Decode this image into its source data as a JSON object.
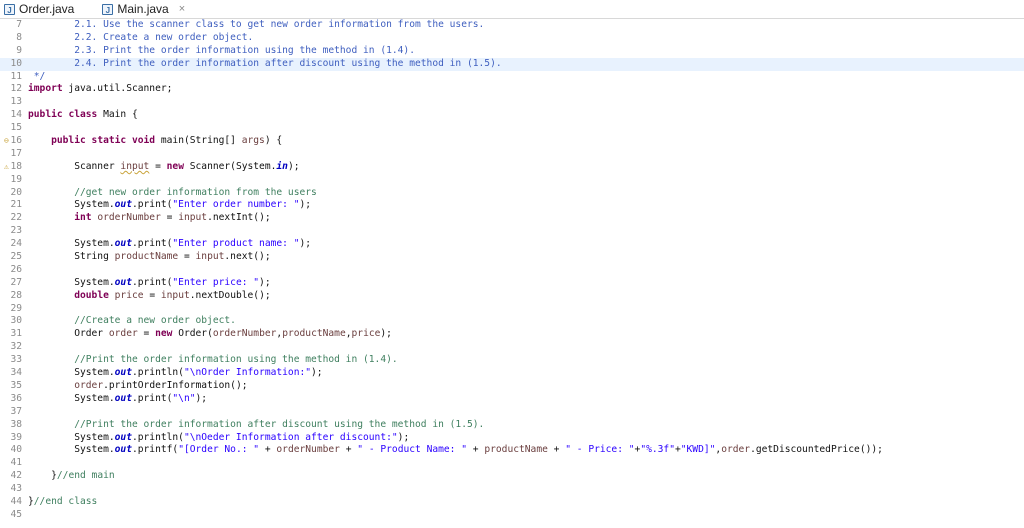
{
  "tabs": [
    {
      "label": "Order.java",
      "active": false
    },
    {
      "label": "Main.java",
      "active": true,
      "close": "×"
    }
  ],
  "editor": {
    "lines": [
      {
        "num": "7",
        "marker": "",
        "segments": [
          {
            "t": "        2.1. Use the scanner class to get new order information from the users.",
            "c": "doc"
          }
        ]
      },
      {
        "num": "8",
        "marker": "",
        "segments": [
          {
            "t": "        2.2. Create a new order object.",
            "c": "doc"
          }
        ]
      },
      {
        "num": "9",
        "marker": "",
        "segments": [
          {
            "t": "        2.3. Print the order information using the method in (1.4).",
            "c": "doc"
          }
        ]
      },
      {
        "num": "10",
        "marker": "",
        "hl": true,
        "segments": [
          {
            "t": "        2.4. Print the order information after discount using the method in (1.5).",
            "c": "doc"
          }
        ]
      },
      {
        "num": "11",
        "marker": "",
        "segments": [
          {
            "t": " */",
            "c": "doc"
          }
        ]
      },
      {
        "num": "12",
        "marker": "",
        "segments": [
          {
            "t": "import",
            "c": "kw"
          },
          {
            "t": " java.util.Scanner;",
            "c": ""
          }
        ]
      },
      {
        "num": "13",
        "marker": "",
        "segments": []
      },
      {
        "num": "14",
        "marker": "",
        "segments": [
          {
            "t": "public",
            "c": "kw"
          },
          {
            "t": " ",
            "c": ""
          },
          {
            "t": "class",
            "c": "kw"
          },
          {
            "t": " Main {",
            "c": ""
          }
        ]
      },
      {
        "num": "15",
        "marker": "",
        "segments": []
      },
      {
        "num": "16",
        "marker": "⊖",
        "segments": [
          {
            "t": "    ",
            "c": ""
          },
          {
            "t": "public",
            "c": "kw"
          },
          {
            "t": " ",
            "c": ""
          },
          {
            "t": "static",
            "c": "kw"
          },
          {
            "t": " ",
            "c": ""
          },
          {
            "t": "void",
            "c": "kw"
          },
          {
            "t": " main(String[] ",
            "c": ""
          },
          {
            "t": "args",
            "c": "var"
          },
          {
            "t": ") {",
            "c": ""
          }
        ]
      },
      {
        "num": "17",
        "marker": "",
        "segments": []
      },
      {
        "num": "18",
        "marker": "⚠",
        "segments": [
          {
            "t": "        Scanner ",
            "c": ""
          },
          {
            "t": "input",
            "c": "var warn"
          },
          {
            "t": " = ",
            "c": ""
          },
          {
            "t": "new",
            "c": "kw"
          },
          {
            "t": " Scanner(System.",
            "c": ""
          },
          {
            "t": "in",
            "c": "fld"
          },
          {
            "t": ");",
            "c": ""
          }
        ]
      },
      {
        "num": "19",
        "marker": "",
        "segments": []
      },
      {
        "num": "20",
        "marker": "",
        "segments": [
          {
            "t": "        //get new order information from the users",
            "c": "com"
          }
        ]
      },
      {
        "num": "21",
        "marker": "",
        "segments": [
          {
            "t": "        System.",
            "c": ""
          },
          {
            "t": "out",
            "c": "fld"
          },
          {
            "t": ".print(",
            "c": ""
          },
          {
            "t": "\"Enter order number: \"",
            "c": "str"
          },
          {
            "t": ");",
            "c": ""
          }
        ]
      },
      {
        "num": "22",
        "marker": "",
        "segments": [
          {
            "t": "        ",
            "c": ""
          },
          {
            "t": "int",
            "c": "kw"
          },
          {
            "t": " ",
            "c": ""
          },
          {
            "t": "orderNumber",
            "c": "var"
          },
          {
            "t": " = ",
            "c": ""
          },
          {
            "t": "input",
            "c": "var"
          },
          {
            "t": ".nextInt();",
            "c": ""
          }
        ]
      },
      {
        "num": "23",
        "marker": "",
        "segments": []
      },
      {
        "num": "24",
        "marker": "",
        "segments": [
          {
            "t": "        System.",
            "c": ""
          },
          {
            "t": "out",
            "c": "fld"
          },
          {
            "t": ".print(",
            "c": ""
          },
          {
            "t": "\"Enter product name: \"",
            "c": "str"
          },
          {
            "t": ");",
            "c": ""
          }
        ]
      },
      {
        "num": "25",
        "marker": "",
        "segments": [
          {
            "t": "        String ",
            "c": ""
          },
          {
            "t": "productName",
            "c": "var"
          },
          {
            "t": " = ",
            "c": ""
          },
          {
            "t": "input",
            "c": "var"
          },
          {
            "t": ".next();",
            "c": ""
          }
        ]
      },
      {
        "num": "26",
        "marker": "",
        "segments": []
      },
      {
        "num": "27",
        "marker": "",
        "segments": [
          {
            "t": "        System.",
            "c": ""
          },
          {
            "t": "out",
            "c": "fld"
          },
          {
            "t": ".print(",
            "c": ""
          },
          {
            "t": "\"Enter price: \"",
            "c": "str"
          },
          {
            "t": ");",
            "c": ""
          }
        ]
      },
      {
        "num": "28",
        "marker": "",
        "segments": [
          {
            "t": "        ",
            "c": ""
          },
          {
            "t": "double",
            "c": "kw"
          },
          {
            "t": " ",
            "c": ""
          },
          {
            "t": "price",
            "c": "var"
          },
          {
            "t": " = ",
            "c": ""
          },
          {
            "t": "input",
            "c": "var"
          },
          {
            "t": ".nextDouble();",
            "c": ""
          }
        ]
      },
      {
        "num": "29",
        "marker": "",
        "segments": []
      },
      {
        "num": "30",
        "marker": "",
        "segments": [
          {
            "t": "        //Create a new order object.",
            "c": "com"
          }
        ]
      },
      {
        "num": "31",
        "marker": "",
        "segments": [
          {
            "t": "        Order ",
            "c": ""
          },
          {
            "t": "order",
            "c": "var"
          },
          {
            "t": " = ",
            "c": ""
          },
          {
            "t": "new",
            "c": "kw"
          },
          {
            "t": " Order(",
            "c": ""
          },
          {
            "t": "orderNumber",
            "c": "var"
          },
          {
            "t": ",",
            "c": ""
          },
          {
            "t": "productName",
            "c": "var"
          },
          {
            "t": ",",
            "c": ""
          },
          {
            "t": "price",
            "c": "var"
          },
          {
            "t": ");",
            "c": ""
          }
        ]
      },
      {
        "num": "32",
        "marker": "",
        "segments": []
      },
      {
        "num": "33",
        "marker": "",
        "segments": [
          {
            "t": "        //Print the order information using the method in (1.4).",
            "c": "com"
          }
        ]
      },
      {
        "num": "34",
        "marker": "",
        "segments": [
          {
            "t": "        System.",
            "c": ""
          },
          {
            "t": "out",
            "c": "fld"
          },
          {
            "t": ".println(",
            "c": ""
          },
          {
            "t": "\"\\nOrder Information:\"",
            "c": "str"
          },
          {
            "t": ");",
            "c": ""
          }
        ]
      },
      {
        "num": "35",
        "marker": "",
        "segments": [
          {
            "t": "        ",
            "c": ""
          },
          {
            "t": "order",
            "c": "var"
          },
          {
            "t": ".printOrderInformation();",
            "c": ""
          }
        ]
      },
      {
        "num": "36",
        "marker": "",
        "segments": [
          {
            "t": "        System.",
            "c": ""
          },
          {
            "t": "out",
            "c": "fld"
          },
          {
            "t": ".print(",
            "c": ""
          },
          {
            "t": "\"\\n\"",
            "c": "str"
          },
          {
            "t": ");",
            "c": ""
          }
        ]
      },
      {
        "num": "37",
        "marker": "",
        "segments": []
      },
      {
        "num": "38",
        "marker": "",
        "segments": [
          {
            "t": "        //Print the order information after discount using the method in (1.5).",
            "c": "com"
          }
        ]
      },
      {
        "num": "39",
        "marker": "",
        "segments": [
          {
            "t": "        System.",
            "c": ""
          },
          {
            "t": "out",
            "c": "fld"
          },
          {
            "t": ".println(",
            "c": ""
          },
          {
            "t": "\"\\nOeder Information after discount:\"",
            "c": "str"
          },
          {
            "t": ");",
            "c": ""
          }
        ]
      },
      {
        "num": "40",
        "marker": "",
        "segments": [
          {
            "t": "        System.",
            "c": ""
          },
          {
            "t": "out",
            "c": "fld"
          },
          {
            "t": ".printf(",
            "c": ""
          },
          {
            "t": "\"[Order No.: \"",
            "c": "str"
          },
          {
            "t": " + ",
            "c": ""
          },
          {
            "t": "orderNumber",
            "c": "var"
          },
          {
            "t": " + ",
            "c": ""
          },
          {
            "t": "\" - Product Name: \"",
            "c": "str"
          },
          {
            "t": " + ",
            "c": ""
          },
          {
            "t": "productName",
            "c": "var"
          },
          {
            "t": " + ",
            "c": ""
          },
          {
            "t": "\" - Price: \"",
            "c": "str"
          },
          {
            "t": "+",
            "c": ""
          },
          {
            "t": "\"%.3f\"",
            "c": "str"
          },
          {
            "t": "+",
            "c": ""
          },
          {
            "t": "\"KWD]\"",
            "c": "str"
          },
          {
            "t": ",",
            "c": ""
          },
          {
            "t": "order",
            "c": "var"
          },
          {
            "t": ".getDiscountedPrice());",
            "c": ""
          }
        ]
      },
      {
        "num": "41",
        "marker": "",
        "segments": []
      },
      {
        "num": "42",
        "marker": "",
        "segments": [
          {
            "t": "    }",
            "c": ""
          },
          {
            "t": "//end main",
            "c": "com"
          }
        ]
      },
      {
        "num": "43",
        "marker": "",
        "segments": []
      },
      {
        "num": "44",
        "marker": "",
        "segments": [
          {
            "t": "}",
            "c": ""
          },
          {
            "t": "//end class",
            "c": "com"
          }
        ]
      },
      {
        "num": "45",
        "marker": "",
        "segments": []
      }
    ]
  }
}
